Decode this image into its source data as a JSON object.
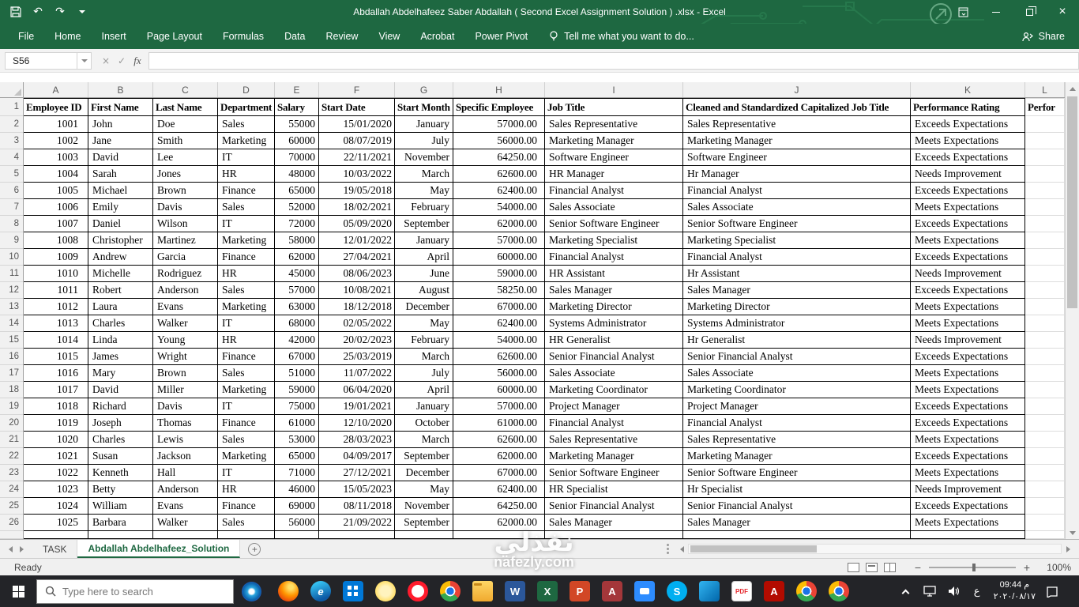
{
  "title_bar": {
    "title": "Abdallah Abdelhafeez Saber Abdallah ( Second Excel Assignment Solution ) .xlsx - Excel",
    "icons": {
      "undo": "↶",
      "redo": "↷"
    }
  },
  "ribbon": {
    "tabs": [
      "File",
      "Home",
      "Insert",
      "Page Layout",
      "Formulas",
      "Data",
      "Review",
      "View",
      "Acrobat",
      "Power Pivot"
    ],
    "tell_me": "Tell me what you want to do...",
    "share_label": "Share"
  },
  "formula_bar": {
    "name_box": "S56",
    "formula": "",
    "icons": {
      "cancel": "×",
      "enter": "✓",
      "fx": "fx"
    }
  },
  "sheet": {
    "col_letters": [
      "A",
      "B",
      "C",
      "D",
      "E",
      "F",
      "G",
      "H",
      "I",
      "J",
      "K",
      "L"
    ],
    "header_row": [
      "Employee ID",
      "First Name",
      "Last Name",
      "Department",
      "Salary",
      "Start Date",
      "Start Month",
      "Specific Employee",
      "Job Title",
      "Cleaned and Standardized Capitalized Job Title",
      "Performance Rating",
      "Perfor"
    ],
    "rows": [
      [
        "1001",
        "John",
        "Doe",
        "Sales",
        "55000",
        "15/01/2020",
        "January",
        "57000.00",
        "Sales Representative",
        "Sales Representative",
        "Exceeds Expectations"
      ],
      [
        "1002",
        "Jane",
        "Smith",
        "Marketing",
        "60000",
        "08/07/2019",
        "July",
        "56000.00",
        "Marketing Manager",
        "Marketing Manager",
        "Meets Expectations"
      ],
      [
        "1003",
        "David",
        "Lee",
        "IT",
        "70000",
        "22/11/2021",
        "November",
        "64250.00",
        "Software Engineer",
        "Software Engineer",
        "Exceeds Expectations"
      ],
      [
        "1004",
        "Sarah",
        "Jones",
        "HR",
        "48000",
        "10/03/2022",
        "March",
        "62600.00",
        "HR Manager",
        "Hr Manager",
        "Needs Improvement"
      ],
      [
        "1005",
        "Michael",
        "Brown",
        "Finance",
        "65000",
        "19/05/2018",
        "May",
        "62400.00",
        "Financial Analyst",
        "Financial Analyst",
        "Exceeds Expectations"
      ],
      [
        "1006",
        "Emily",
        "Davis",
        "Sales",
        "52000",
        "18/02/2021",
        "February",
        "54000.00",
        "Sales Associate",
        "Sales Associate",
        "Meets Expectations"
      ],
      [
        "1007",
        "Daniel",
        "Wilson",
        "IT",
        "72000",
        "05/09/2020",
        "September",
        "62000.00",
        "Senior Software Engineer",
        "Senior Software Engineer",
        "Exceeds Expectations"
      ],
      [
        "1008",
        "Christopher",
        "Martinez",
        "Marketing",
        "58000",
        "12/01/2022",
        "January",
        "57000.00",
        "Marketing Specialist",
        "Marketing Specialist",
        "Meets Expectations"
      ],
      [
        "1009",
        "Andrew",
        "Garcia",
        "Finance",
        "62000",
        "27/04/2021",
        "April",
        "60000.00",
        "Financial Analyst",
        "Financial Analyst",
        "Exceeds Expectations"
      ],
      [
        "1010",
        "Michelle",
        "Rodriguez",
        "HR",
        "45000",
        "08/06/2023",
        "June",
        "59000.00",
        "HR Assistant",
        "Hr Assistant",
        "Needs Improvement"
      ],
      [
        "1011",
        "Robert",
        "Anderson",
        "Sales",
        "57000",
        "10/08/2021",
        "August",
        "58250.00",
        "Sales Manager",
        "Sales Manager",
        "Exceeds Expectations"
      ],
      [
        "1012",
        "Laura",
        "Evans",
        "Marketing",
        "63000",
        "18/12/2018",
        "December",
        "67000.00",
        "Marketing Director",
        "Marketing Director",
        "Meets Expectations"
      ],
      [
        "1013",
        "Charles",
        "Walker",
        "IT",
        "68000",
        "02/05/2022",
        "May",
        "62400.00",
        "Systems Administrator",
        "Systems Administrator",
        "Meets Expectations"
      ],
      [
        "1014",
        "Linda",
        "Young",
        "HR",
        "42000",
        "20/02/2023",
        "February",
        "54000.00",
        "HR Generalist",
        "Hr Generalist",
        "Needs Improvement"
      ],
      [
        "1015",
        "James",
        "Wright",
        "Finance",
        "67000",
        "25/03/2019",
        "March",
        "62600.00",
        "Senior Financial Analyst",
        "Senior Financial Analyst",
        "Exceeds Expectations"
      ],
      [
        "1016",
        "Mary",
        "Brown",
        "Sales",
        "51000",
        "11/07/2022",
        "July",
        "56000.00",
        "Sales Associate",
        "Sales Associate",
        "Meets Expectations"
      ],
      [
        "1017",
        "David",
        "Miller",
        "Marketing",
        "59000",
        "06/04/2020",
        "April",
        "60000.00",
        "Marketing Coordinator",
        "Marketing Coordinator",
        "Meets Expectations"
      ],
      [
        "1018",
        "Richard",
        "Davis",
        "IT",
        "75000",
        "19/01/2021",
        "January",
        "57000.00",
        "Project Manager",
        "Project Manager",
        "Exceeds Expectations"
      ],
      [
        "1019",
        "Joseph",
        "Thomas",
        "Finance",
        "61000",
        "12/10/2020",
        "October",
        "61000.00",
        "Financial Analyst",
        "Financial Analyst",
        "Exceeds Expectations"
      ],
      [
        "1020",
        "Charles",
        "Lewis",
        "Sales",
        "53000",
        "28/03/2023",
        "March",
        "62600.00",
        "Sales Representative",
        "Sales Representative",
        "Meets Expectations"
      ],
      [
        "1021",
        "Susan",
        "Jackson",
        "Marketing",
        "65000",
        "04/09/2017",
        "September",
        "62000.00",
        "Marketing Manager",
        "Marketing Manager",
        "Exceeds Expectations"
      ],
      [
        "1022",
        "Kenneth",
        "Hall",
        "IT",
        "71000",
        "27/12/2021",
        "December",
        "67000.00",
        "Senior Software Engineer",
        "Senior Software Engineer",
        "Meets Expectations"
      ],
      [
        "1023",
        "Betty",
        "Anderson",
        "HR",
        "46000",
        "15/05/2023",
        "May",
        "62400.00",
        "HR Specialist",
        "Hr Specialist",
        "Needs Improvement"
      ],
      [
        "1024",
        "William",
        "Evans",
        "Finance",
        "69000",
        "08/11/2018",
        "November",
        "64250.00",
        "Senior Financial Analyst",
        "Senior Financial Analyst",
        "Exceeds Expectations"
      ],
      [
        "1025",
        "Barbara",
        "Walker",
        "Sales",
        "56000",
        "21/09/2022",
        "September",
        "62000.00",
        "Sales Manager",
        "Sales Manager",
        "Meets Expectations"
      ]
    ]
  },
  "sheet_tabs": {
    "tabs": [
      {
        "label": "TASK",
        "active": false
      },
      {
        "label": "Abdallah Abdelhafeez_Solution",
        "active": true
      }
    ]
  },
  "status_bar": {
    "status": "Ready",
    "zoom": "100%"
  },
  "taskbar": {
    "search_placeholder": "Type here to search",
    "language": "ع",
    "clock": {
      "time": "09:44 م",
      "date": "٢٠٢٠/٠٨/١٧"
    },
    "icons": [
      {
        "name": "firefox",
        "label": ""
      },
      {
        "name": "edge",
        "label": "e"
      },
      {
        "name": "store",
        "label": ""
      },
      {
        "name": "photos",
        "label": ""
      },
      {
        "name": "opera",
        "label": ""
      },
      {
        "name": "chrome",
        "label": ""
      },
      {
        "name": "file-explorer",
        "label": ""
      },
      {
        "name": "word",
        "label": "W"
      },
      {
        "name": "excel",
        "label": "X"
      },
      {
        "name": "powerpoint",
        "label": "P"
      },
      {
        "name": "access",
        "label": "A"
      },
      {
        "name": "zoom",
        "label": ""
      },
      {
        "name": "skype",
        "label": "S"
      },
      {
        "name": "vscode",
        "label": ""
      },
      {
        "name": "foxit",
        "label": "PDF"
      },
      {
        "name": "acrobat",
        "label": "A"
      },
      {
        "name": "chrome-2",
        "label": ""
      },
      {
        "name": "chrome-3",
        "label": ""
      }
    ]
  },
  "watermark": {
    "arabic": "نفذلي",
    "domain": "nafezly.com"
  }
}
